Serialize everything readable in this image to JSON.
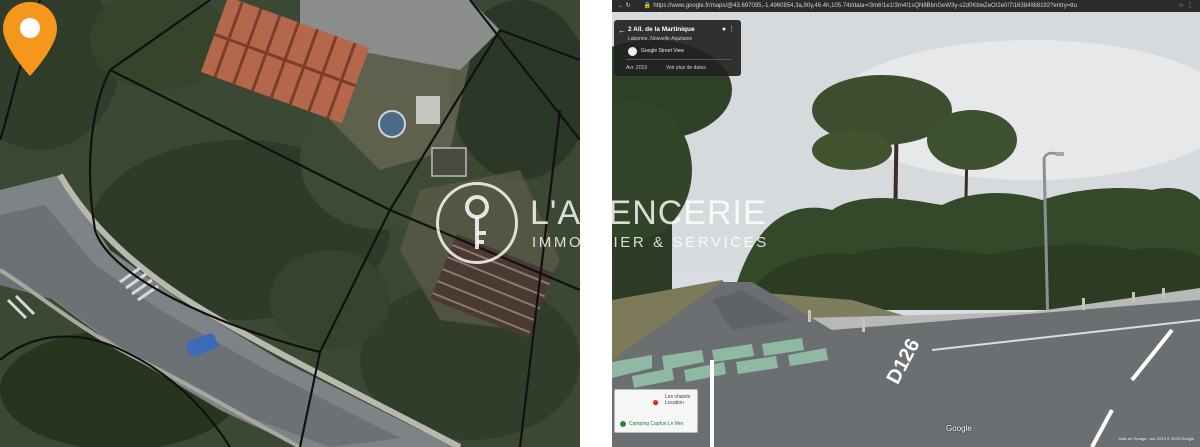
{
  "aerial_map": {
    "marker_color": "#f5961d",
    "marker_icon": "map-pin-icon"
  },
  "street_view": {
    "browser": {
      "url": "https://www.google.fr/maps/@43.697095,-1.4960854,3a,90y,46.4h,105.74t/data=!3m6!1e1!3m4!1sQN8BbnGeW3y-s2d0KbwZeO!2e0!7i16384!8i8192?entry=ttu"
    },
    "place_card": {
      "address": "2 All. de la Martinique",
      "locality": "Labenne, Nouvelle-Aquitaine",
      "provider": "Google Street View",
      "date": "Avr. 2019",
      "more_dates": "Voir plus de dates"
    },
    "minimap": {
      "label_1": "Les chalets",
      "label_2": "Location",
      "poi": "Camping Capfun Le Mer"
    },
    "road_marking": "D126",
    "google_logo": "Google",
    "credits": "Date de l'image : oct. 2019   © 2023 Google"
  },
  "watermark": {
    "brand": "L'AGENCERIE",
    "tagline": "IMMOBILIER & SERVICES",
    "logo_icon": "key-icon"
  }
}
